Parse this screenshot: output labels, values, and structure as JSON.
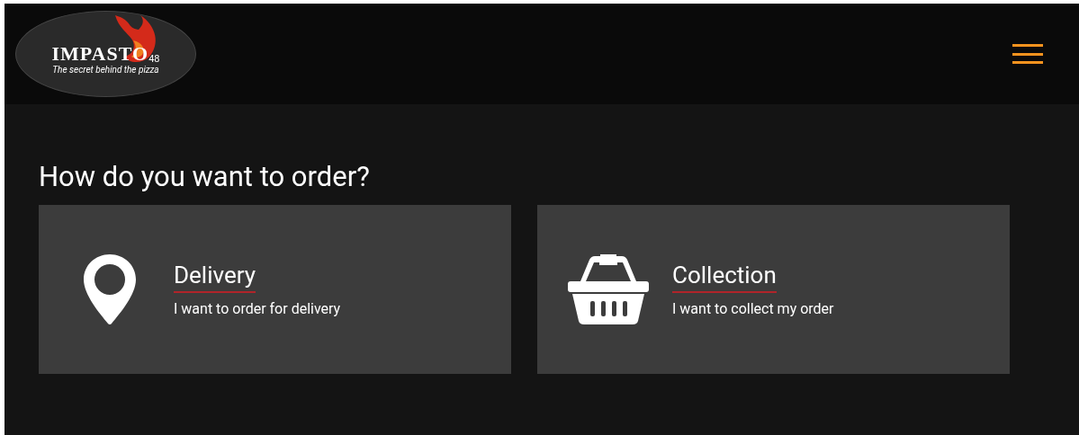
{
  "logo": {
    "name": "IMPASTO",
    "suffix": "48",
    "tagline": "The secret behind the pizza"
  },
  "heading": "How do you want to order?",
  "options": [
    {
      "kind": "delivery",
      "title": "Delivery",
      "subtitle": "I want to order for delivery"
    },
    {
      "kind": "collection",
      "title": "Collection",
      "subtitle": "I want to collect my order"
    }
  ]
}
